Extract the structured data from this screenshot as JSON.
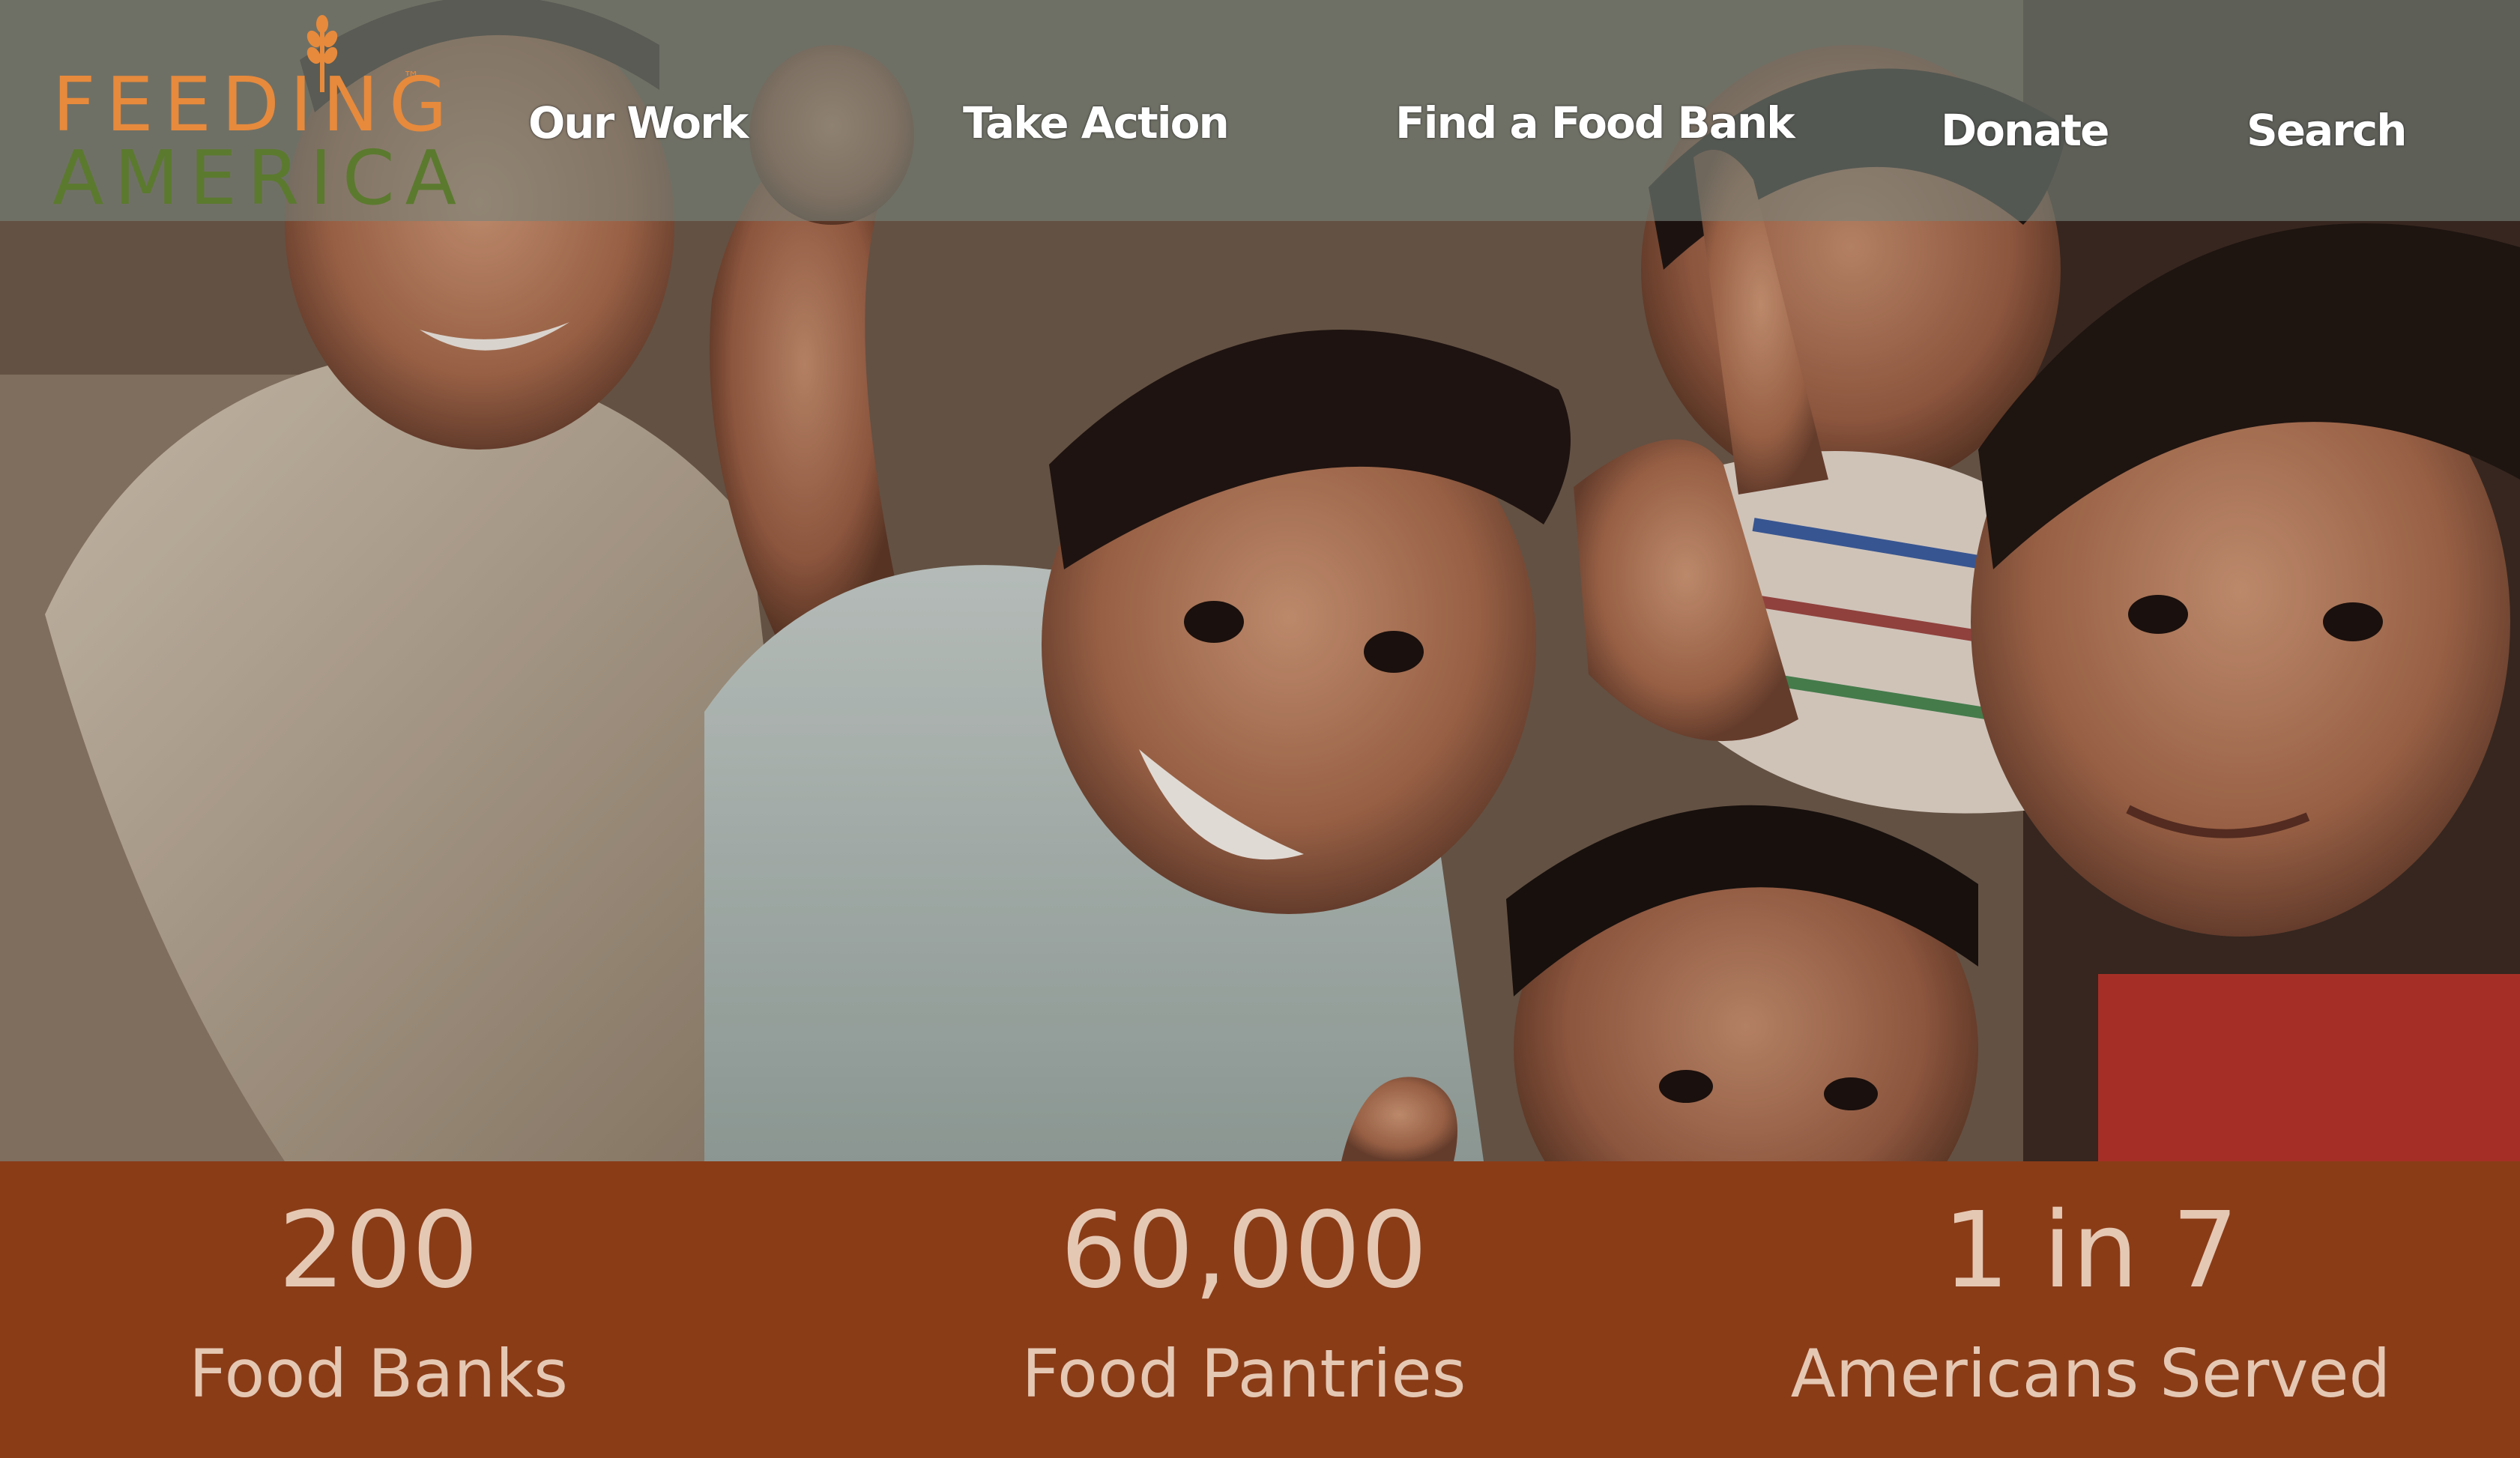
{
  "brand": {
    "logo_line1": "FEEDING",
    "logo_line2": "AMERICA",
    "logo_trademark": "™",
    "logo_colors": {
      "top": "#e78a3c",
      "bottom": "#5b7a2e"
    }
  },
  "nav": {
    "items": [
      {
        "label": "Our Work"
      },
      {
        "label": "Take Action"
      },
      {
        "label": "Find a Food Bank"
      },
      {
        "label": "Donate"
      },
      {
        "label": "Search"
      }
    ]
  },
  "hero": {
    "image": "photo-of-smiling-children-reaching-toward-camera"
  },
  "stats": {
    "background": "#8a3c17",
    "text_color": "#e5c8b4",
    "items": [
      {
        "number": "200",
        "label": "Food Banks"
      },
      {
        "number": "60,000",
        "label": "Food Pantries"
      },
      {
        "number": "1 in 7",
        "label": "Americans Served"
      }
    ]
  }
}
